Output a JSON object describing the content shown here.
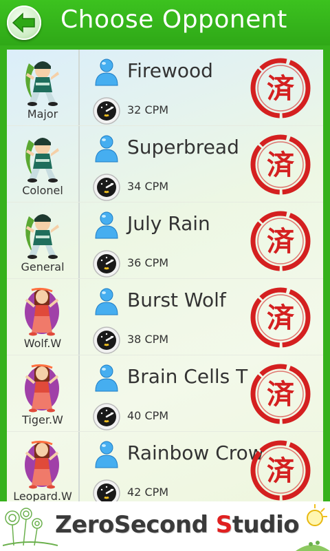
{
  "header": {
    "title": "Choose Opponent",
    "back_icon": "back-arrow-icon"
  },
  "opponents": [
    {
      "rank": "Major",
      "name": "Firewood",
      "cpm": "32 CPM",
      "avatar": "monk",
      "stamp": "済"
    },
    {
      "rank": "Colonel",
      "name": "Superbread",
      "cpm": "34 CPM",
      "avatar": "monk",
      "stamp": "済"
    },
    {
      "rank": "General",
      "name": "July Rain",
      "cpm": "36 CPM",
      "avatar": "monk",
      "stamp": "済"
    },
    {
      "rank": "Wolf.W",
      "name": "Burst Wolf",
      "cpm": "38 CPM",
      "avatar": "dancer",
      "stamp": "済"
    },
    {
      "rank": "Tiger.W",
      "name": "Brain Cells T",
      "cpm": "40 CPM",
      "avatar": "dancer",
      "stamp": "済"
    },
    {
      "rank": "Leopard.W",
      "name": "Rainbow Crow",
      "cpm": "42 CPM",
      "avatar": "dancer",
      "stamp": "済"
    }
  ],
  "footer": {
    "brand_part1": "ZeroSecond ",
    "brand_s": "S",
    "brand_part2": "tudio"
  },
  "colors": {
    "header_green": "#36b11c",
    "stamp_red": "#d42020",
    "user_blue": "#3aa3e8"
  }
}
